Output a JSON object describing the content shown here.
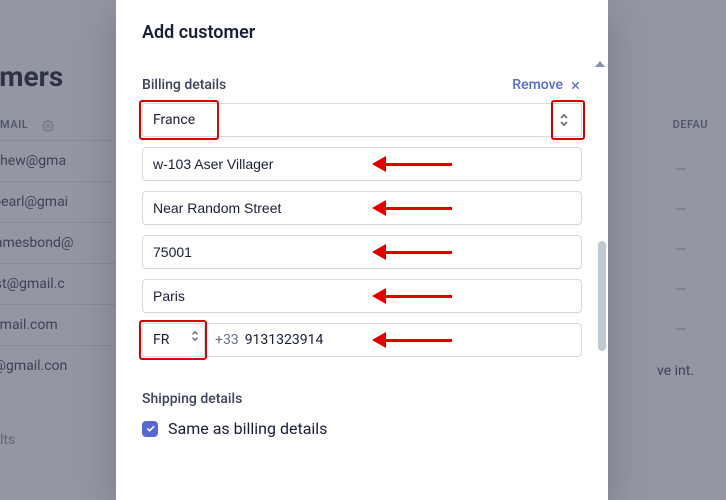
{
  "background": {
    "page_heading": "stomers",
    "columns": {
      "email": "MAIL",
      "default": "DEFAU"
    },
    "rows": [
      "iamatthew@gma",
      "blackpearl@gmai",
      "bondjamesbond@",
      "anetest@gmail.c",
      "est@gmail.com",
      "ukrey@gmail.con"
    ],
    "bottom_text": "lts",
    "right_text": "ve int."
  },
  "modal": {
    "title": "Add customer",
    "billing": {
      "section_label": "Billing details",
      "remove_label": "Remove",
      "country": "France",
      "address1": "w-103 Aser Villager",
      "address2": "Near Random Street",
      "postal_code": "75001",
      "city": "Paris",
      "phone_country": "FR",
      "phone_prefix": "+33",
      "phone_number": "9131323914"
    },
    "shipping": {
      "section_label": "Shipping details",
      "same_label": "Same as billing details",
      "same_checked": true
    }
  }
}
